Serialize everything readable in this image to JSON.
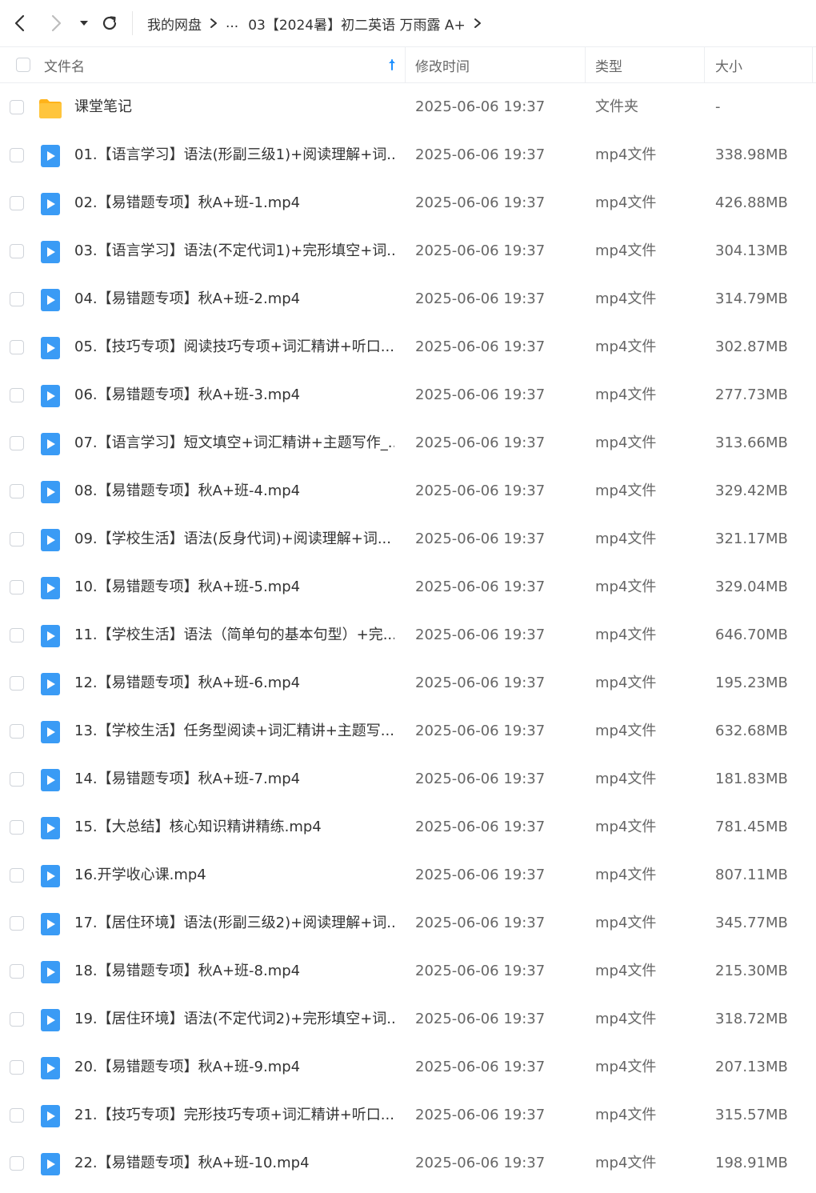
{
  "breadcrumb": {
    "root": "我的网盘",
    "ellipsis": "...",
    "current": "03【2024暑】初二英语 万雨露 A+"
  },
  "columns": {
    "name": "文件名",
    "modified": "修改时间",
    "type": "类型",
    "size": "大小"
  },
  "colors": {
    "accent": "#1e90ff",
    "video_icon": "#3a9bf5",
    "folder": "#ffc53d"
  },
  "files": [
    {
      "name": "课堂笔记",
      "time": "2025-06-06 19:37",
      "type": "文件夹",
      "size": "-",
      "icon": "folder-icon"
    },
    {
      "name": "01.【语言学习】语法(形副三级1)+阅读理解+词...",
      "time": "2025-06-06 19:37",
      "type": "mp4文件",
      "size": "338.98MB",
      "icon": "video-file-icon"
    },
    {
      "name": "02.【易错题专项】秋A+班-1.mp4",
      "time": "2025-06-06 19:37",
      "type": "mp4文件",
      "size": "426.88MB",
      "icon": "video-file-icon"
    },
    {
      "name": "03.【语言学习】语法(不定代词1)+完形填空+词...",
      "time": "2025-06-06 19:37",
      "type": "mp4文件",
      "size": "304.13MB",
      "icon": "video-file-icon"
    },
    {
      "name": "04.【易错题专项】秋A+班-2.mp4",
      "time": "2025-06-06 19:37",
      "type": "mp4文件",
      "size": "314.79MB",
      "icon": "video-file-icon"
    },
    {
      "name": "05.【技巧专项】阅读技巧专项+词汇精讲+听口...",
      "time": "2025-06-06 19:37",
      "type": "mp4文件",
      "size": "302.87MB",
      "icon": "video-file-icon"
    },
    {
      "name": "06.【易错题专项】秋A+班-3.mp4",
      "time": "2025-06-06 19:37",
      "type": "mp4文件",
      "size": "277.73MB",
      "icon": "video-file-icon"
    },
    {
      "name": "07.【语言学习】短文填空+词汇精讲+主题写作_...",
      "time": "2025-06-06 19:37",
      "type": "mp4文件",
      "size": "313.66MB",
      "icon": "video-file-icon"
    },
    {
      "name": "08.【易错题专项】秋A+班-4.mp4",
      "time": "2025-06-06 19:37",
      "type": "mp4文件",
      "size": "329.42MB",
      "icon": "video-file-icon"
    },
    {
      "name": "09.【学校生活】语法(反身代词)+阅读理解+词...",
      "time": "2025-06-06 19:37",
      "type": "mp4文件",
      "size": "321.17MB",
      "icon": "video-file-icon"
    },
    {
      "name": "10.【易错题专项】秋A+班-5.mp4",
      "time": "2025-06-06 19:37",
      "type": "mp4文件",
      "size": "329.04MB",
      "icon": "video-file-icon"
    },
    {
      "name": "11.【学校生活】语法（简单句的基本句型）+完...",
      "time": "2025-06-06 19:37",
      "type": "mp4文件",
      "size": "646.70MB",
      "icon": "video-file-icon"
    },
    {
      "name": "12.【易错题专项】秋A+班-6.mp4",
      "time": "2025-06-06 19:37",
      "type": "mp4文件",
      "size": "195.23MB",
      "icon": "video-file-icon"
    },
    {
      "name": "13.【学校生活】任务型阅读+词汇精讲+主题写...",
      "time": "2025-06-06 19:37",
      "type": "mp4文件",
      "size": "632.68MB",
      "icon": "video-file-icon"
    },
    {
      "name": "14.【易错题专项】秋A+班-7.mp4",
      "time": "2025-06-06 19:37",
      "type": "mp4文件",
      "size": "181.83MB",
      "icon": "video-file-icon"
    },
    {
      "name": "15.【大总结】核心知识精讲精练.mp4",
      "time": "2025-06-06 19:37",
      "type": "mp4文件",
      "size": "781.45MB",
      "icon": "video-file-icon"
    },
    {
      "name": "16.开学收心课.mp4",
      "time": "2025-06-06 19:37",
      "type": "mp4文件",
      "size": "807.11MB",
      "icon": "video-file-icon"
    },
    {
      "name": "17.【居住环境】语法(形副三级2)+阅读理解+词...",
      "time": "2025-06-06 19:37",
      "type": "mp4文件",
      "size": "345.77MB",
      "icon": "video-file-icon"
    },
    {
      "name": "18.【易错题专项】秋A+班-8.mp4",
      "time": "2025-06-06 19:37",
      "type": "mp4文件",
      "size": "215.30MB",
      "icon": "video-file-icon"
    },
    {
      "name": "19.【居住环境】语法(不定代词2)+完形填空+词...",
      "time": "2025-06-06 19:37",
      "type": "mp4文件",
      "size": "318.72MB",
      "icon": "video-file-icon"
    },
    {
      "name": "20.【易错题专项】秋A+班-9.mp4",
      "time": "2025-06-06 19:37",
      "type": "mp4文件",
      "size": "207.13MB",
      "icon": "video-file-icon"
    },
    {
      "name": "21.【技巧专项】完形技巧专项+词汇精讲+听口...",
      "time": "2025-06-06 19:37",
      "type": "mp4文件",
      "size": "315.57MB",
      "icon": "video-file-icon"
    },
    {
      "name": "22.【易错题专项】秋A+班-10.mp4",
      "time": "2025-06-06 19:37",
      "type": "mp4文件",
      "size": "198.91MB",
      "icon": "video-file-icon"
    }
  ]
}
